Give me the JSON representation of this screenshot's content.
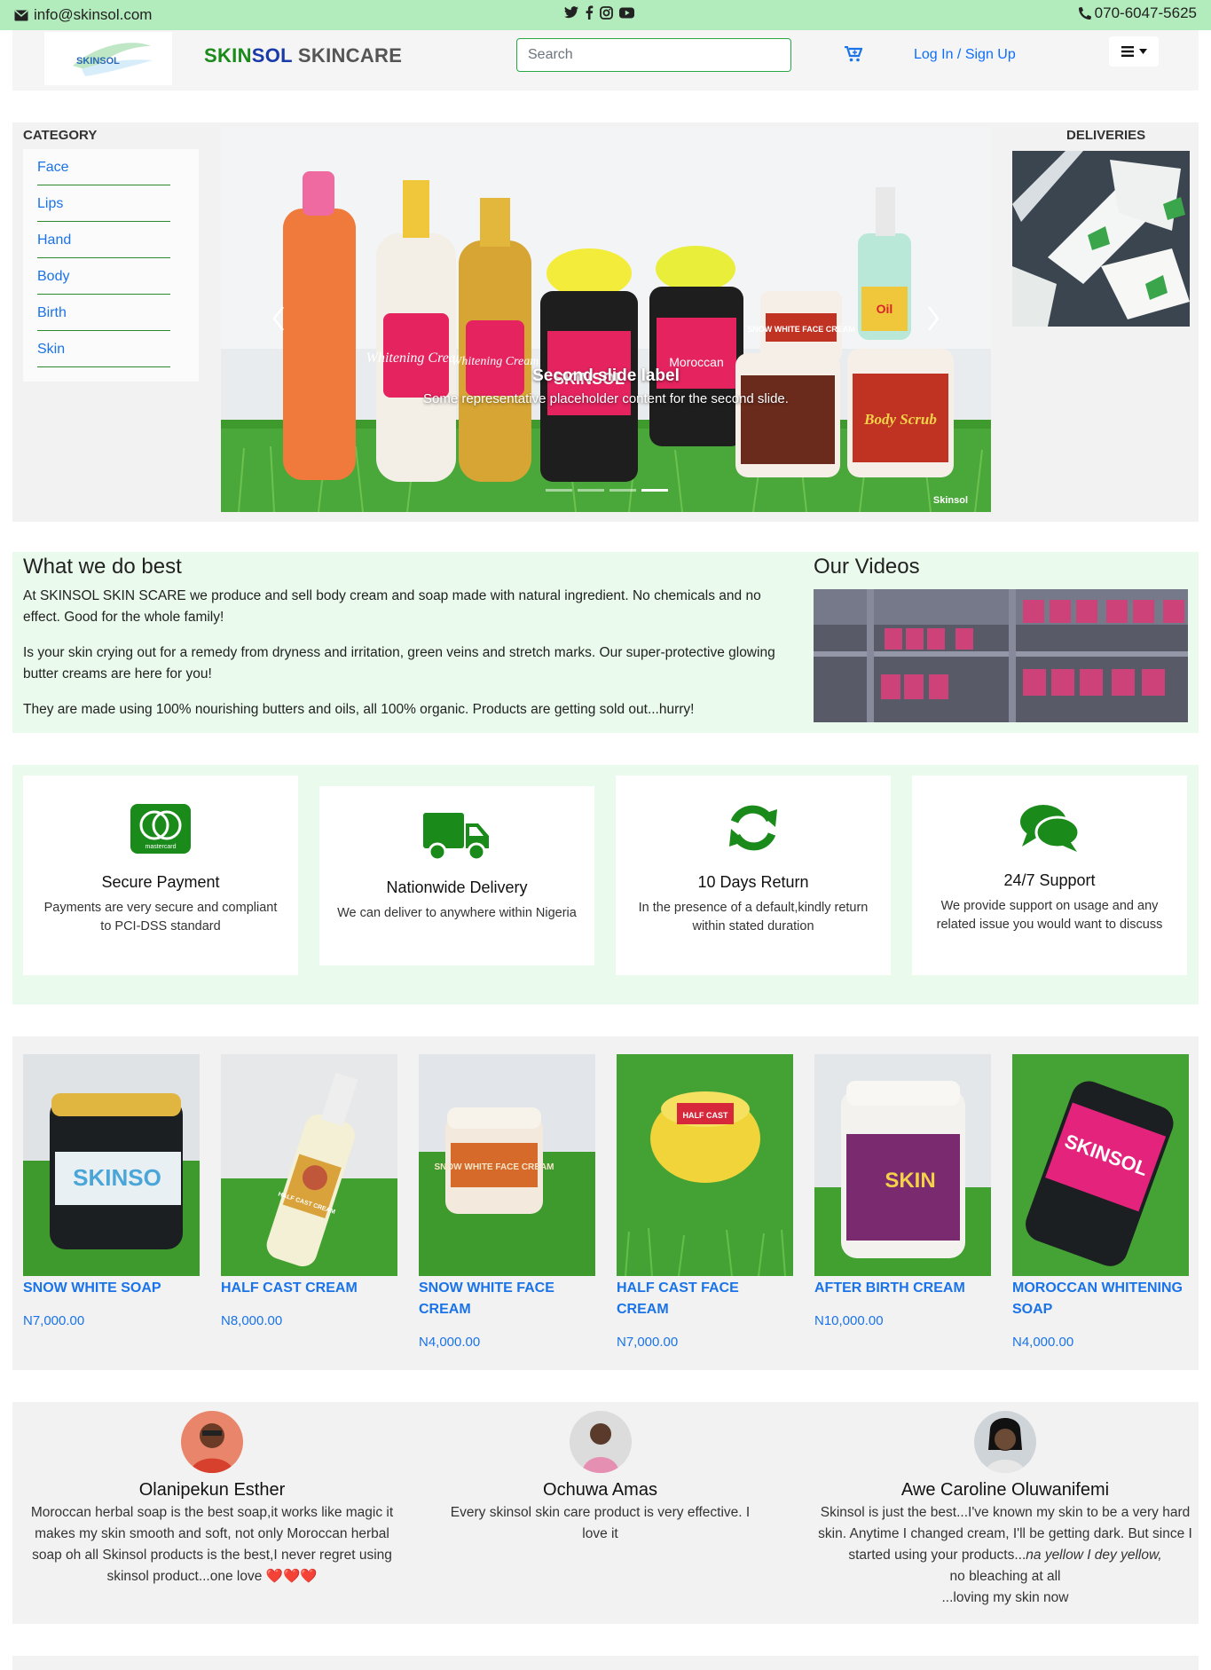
{
  "topbar": {
    "email": "info@skinsol.com",
    "phone": "070-6047-5625",
    "social_icons": [
      "twitter-icon",
      "facebook-icon",
      "instagram-icon",
      "youtube-icon"
    ]
  },
  "nav": {
    "logo_text": "SKINSOL",
    "brand_part1": "SKIN",
    "brand_part2": "SOL",
    "brand_part3": "SKINCARE",
    "search_placeholder": "Search",
    "login_label": "Log In / Sign Up"
  },
  "sidebar": {
    "title": "CATEGORY",
    "items": [
      "Face",
      "Lips",
      "Hand",
      "Body",
      "Birth",
      "Skin"
    ]
  },
  "carousel": {
    "caption_title": "Second slide label",
    "caption_text": "Some representative placeholder content for the second slide.",
    "indicators": 4,
    "active_indicator": 3,
    "label_bottle1": "Whitening Cream",
    "label_bottle2": "Whitening Cream",
    "label_jar1": "SKINSOL",
    "label_jar2": "Moroccan",
    "label_jar3": "SNOW WHITE FACE CREAM",
    "label_jar4": "Body Scrub",
    "label_spray": "Oil",
    "watermark": "Skinsol"
  },
  "deliveries": {
    "title": "DELIVERIES"
  },
  "about": {
    "title": "What we do best",
    "p1": "At SKINSOL SKIN SCARE we produce and sell body cream and soap made with natural ingredient. No chemicals and no effect. Good for the whole family!",
    "p2": "Is your skin crying out for a remedy from dryness and irritation, green veins and stretch marks. Our super-protective glowing butter creams are here for you!",
    "p3": "They are made using 100% nourishing butters and oils, all 100% organic. Products are getting sold out...hurry!",
    "videos_title": "Our Videos"
  },
  "features": [
    {
      "icon": "mastercard-icon",
      "title": "Secure Payment",
      "text": "Payments are very secure and compliant to PCI-DSS standard"
    },
    {
      "icon": "truck-icon",
      "title": "Nationwide Delivery",
      "text": "We can deliver to anywhere within Nigeria"
    },
    {
      "icon": "refresh-icon",
      "title": "10 Days Return",
      "text": "In the presence of a default,kindly return within stated duration"
    },
    {
      "icon": "chat-icon",
      "title": "24/7 Support",
      "text": "We provide support on usage and any related issue you would want to discuss"
    }
  ],
  "mastercard_word": "mastercard",
  "products": [
    {
      "name": "SNOW WHITE SOAP",
      "price": "N7,000.00",
      "label": "SKINSO"
    },
    {
      "name": "HALF CAST CREAM",
      "price": "N8,000.00",
      "label": "HALF CAST CREAM"
    },
    {
      "name": "SNOW WHITE FACE CREAM",
      "price": "N4,000.00",
      "label": "SNOW WHITE FACE CREAM"
    },
    {
      "name": "HALF CAST FACE CREAM",
      "price": "N7,000.00",
      "label": "HALF CAST"
    },
    {
      "name": "AFTER BIRTH CREAM",
      "price": "N10,000.00",
      "label": "SKIN"
    },
    {
      "name": "MOROCCAN WHITENING SOAP",
      "price": "N4,000.00",
      "label": "SKINSOL"
    }
  ],
  "reviews": [
    {
      "name": "Olanipekun Esther",
      "text": "Moroccan herbal soap is the best soap,it works like magic it makes my skin smooth and soft, not only Moroccan herbal soap oh all Skinsol products is the best,I never regret using skinsol product...one love"
    },
    {
      "name": "Ochuwa Amas",
      "text": "Every skinsol skin care product is very effective. I love it"
    },
    {
      "name": "Awe Caroline Oluwanifemi",
      "text_a": "Skinsol is just the best...I've known my skin to be a very hard skin. Anytime I changed cream, I'll be getting dark. But since I started using your products...",
      "text_b": "na yellow I dey yellow,",
      "text_c": "no bleaching at all",
      "text_d": "...loving my skin now"
    }
  ],
  "colors": {
    "topbar": "#b3ecbc",
    "brand_green": "#1a8a1a",
    "brand_blue": "#1a3aa8",
    "link_blue": "#1a73e8",
    "feature_green": "#1a8a1a",
    "section_green": "#eafaec"
  }
}
